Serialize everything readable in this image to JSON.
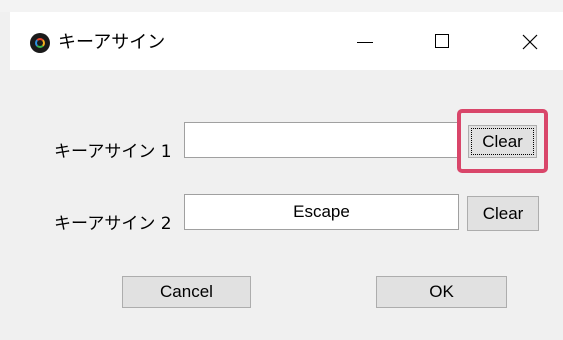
{
  "window": {
    "title": "キーアサイン",
    "controls": {
      "minimize": "minimize-icon",
      "maximize": "maximize-icon",
      "close": "close-icon"
    }
  },
  "form": {
    "rows": [
      {
        "label": "キーアサイン 1",
        "value": "",
        "clear_label": "Clear"
      },
      {
        "label": "キーアサイン 2",
        "value": "Escape",
        "clear_label": "Clear"
      }
    ]
  },
  "footer": {
    "cancel_label": "Cancel",
    "ok_label": "OK"
  },
  "colors": {
    "highlight": "#d9466a",
    "button_face": "#e1e1e1",
    "dialog_bg": "#f0f0f0"
  }
}
